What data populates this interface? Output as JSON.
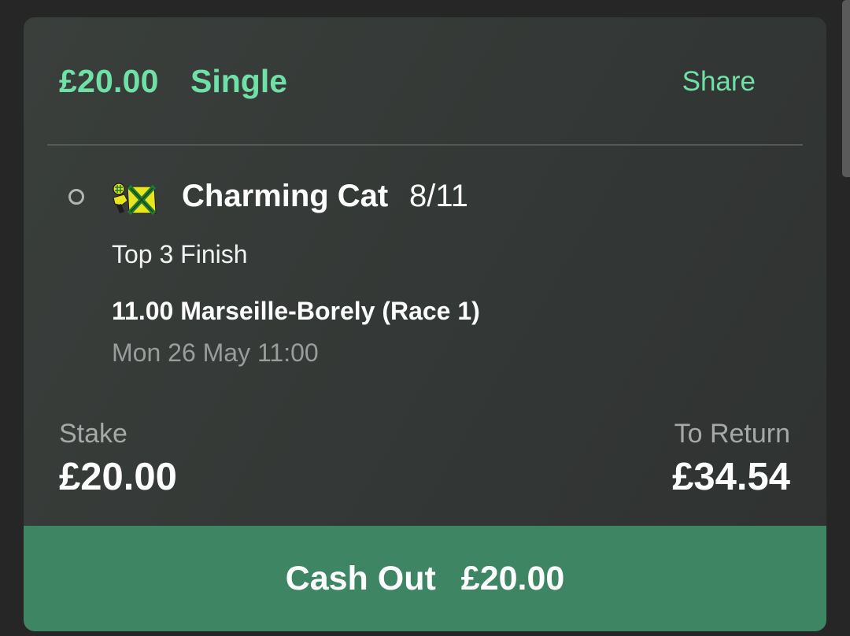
{
  "bet": {
    "stake_title": "£20.00",
    "type": "Single",
    "share_label": "Share"
  },
  "selection": {
    "runner": "Charming Cat",
    "odds": "8/11",
    "market": "Top 3 Finish",
    "event": "11.00 Marseille-Borely (Race 1)",
    "event_time": "Mon 26 May 11:00",
    "status_icon": "open-circle-icon",
    "silks_icon": "jockey-silks-icon",
    "silks_colors": {
      "base": "#e8e41e",
      "cross": "#1f7a2e"
    }
  },
  "summary": {
    "stake_label": "Stake",
    "stake_value": "£20.00",
    "return_label": "To Return",
    "return_value": "£34.54"
  },
  "cashout": {
    "label": "Cash Out",
    "amount": "£20.00",
    "color": "#3e8563"
  },
  "theme": {
    "accent": "#6fe0a6",
    "card_bg": "#333735",
    "page_bg": "#262626"
  }
}
